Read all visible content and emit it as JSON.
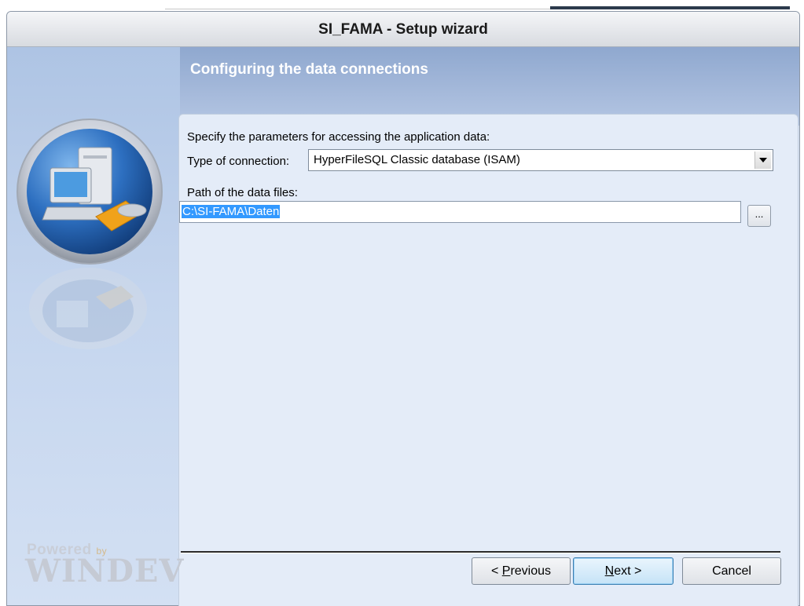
{
  "window": {
    "title": "SI_FAMA - Setup wizard"
  },
  "header": {
    "title": "Configuring the data connections"
  },
  "form": {
    "intro": "Specify the parameters for accessing the application data:",
    "connection_label": "Type of connection:",
    "connection_value": "HyperFileSQL Classic database (ISAM)",
    "path_label": "Path of the data files:",
    "path_value": "C:\\SI-FAMA\\Daten",
    "browse_label": "..."
  },
  "buttons": {
    "previous_prefix": "< ",
    "previous_mnemonic": "P",
    "previous_rest": "revious",
    "next_mnemonic": "N",
    "next_rest": "ext >",
    "cancel": "Cancel"
  },
  "branding": {
    "powered": "Powered",
    "by": "by",
    "product": "WINDEV"
  },
  "colors": {
    "selection": "#3399ff",
    "header_bg": "#a6badb",
    "panel_bg": "#e4ecf8"
  }
}
